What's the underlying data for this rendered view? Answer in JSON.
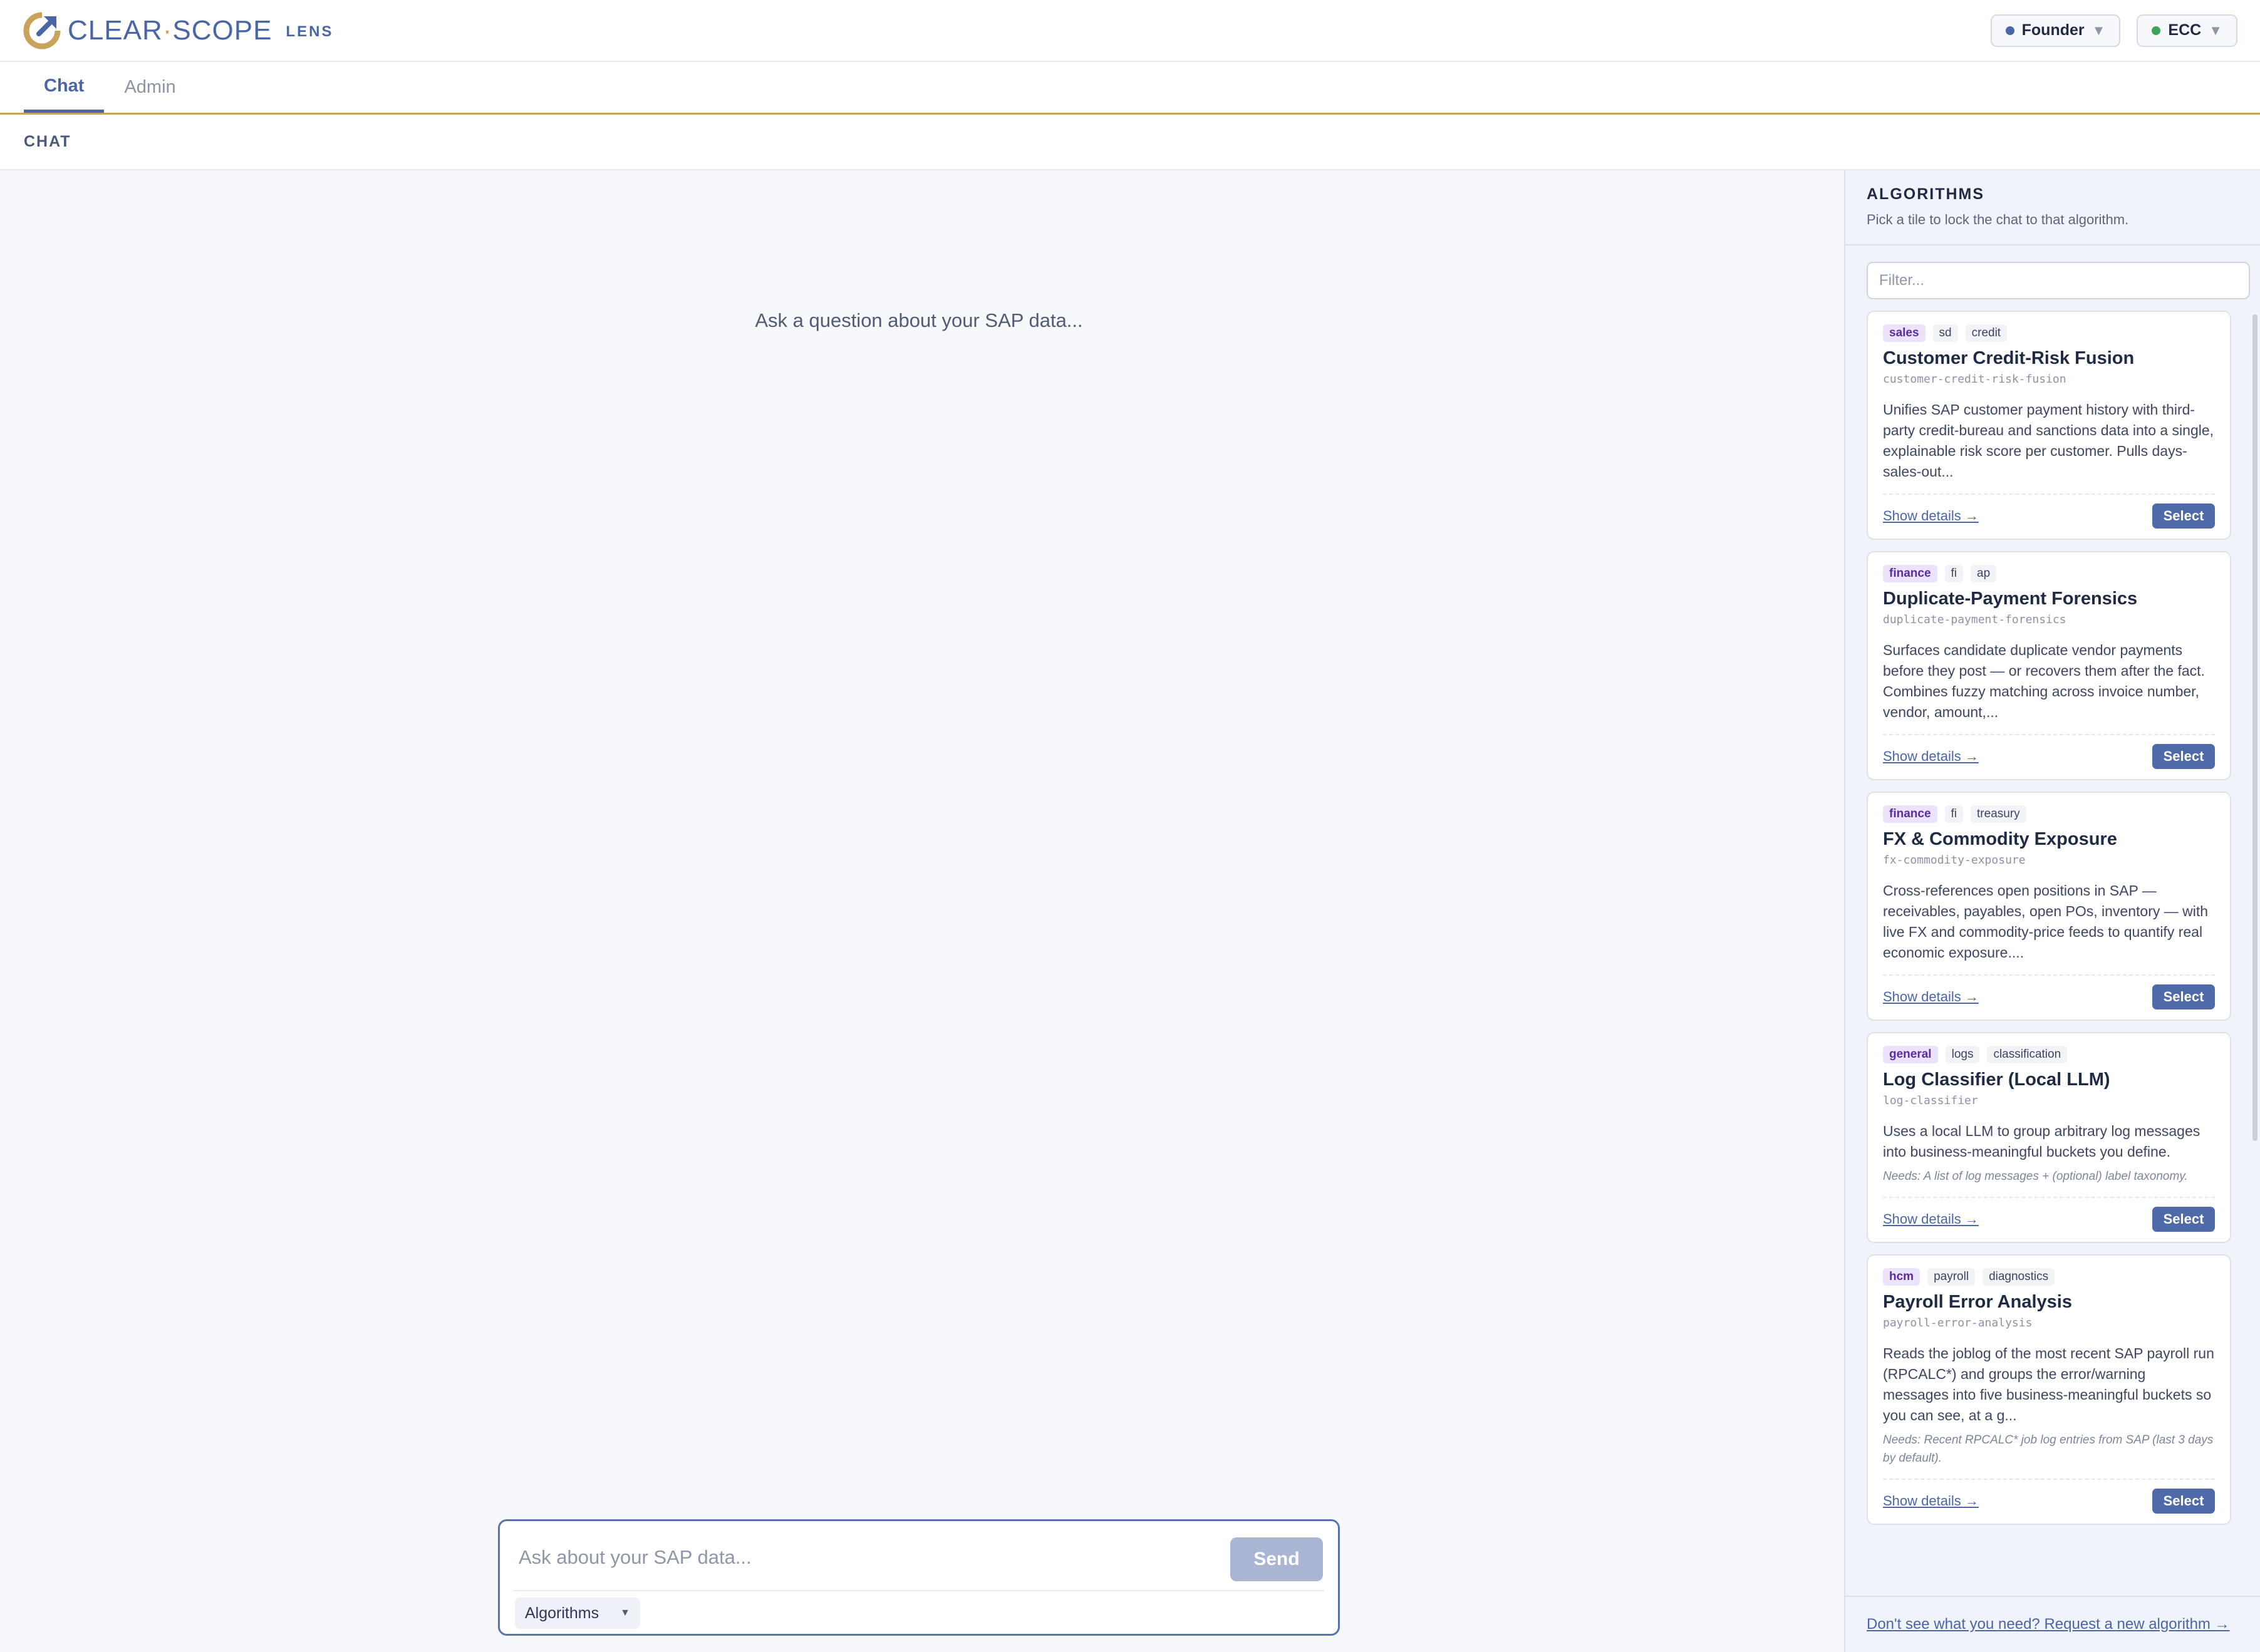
{
  "brand": {
    "name_left": "CLEAR",
    "separator": "·",
    "name_right": "SCOPE",
    "product": "LENS",
    "primary_color": "#4b66a6",
    "accent_color": "#c9a35c"
  },
  "header": {
    "role_selector": {
      "label": "Founder",
      "dot_color": "#4b66a6"
    },
    "system_selector": {
      "label": "ECC",
      "dot_color": "#3fa45b"
    },
    "caret": "▼"
  },
  "tabs": [
    {
      "label": "Chat",
      "active": true
    },
    {
      "label": "Admin",
      "active": false
    }
  ],
  "section": {
    "title": "CHAT"
  },
  "chat": {
    "empty_hint": "Ask a question about your SAP data...",
    "input_placeholder": "Ask about your SAP data...",
    "send_label": "Send",
    "algorithms_dropdown": "Algorithms"
  },
  "algorithms_panel": {
    "title": "ALGORITHMS",
    "subtitle": "Pick a tile to lock the chat to that algorithm.",
    "filter_placeholder": "Filter...",
    "footer_link": "Don't see what you need? Request a new algorithm →",
    "cards": [
      {
        "tags": [
          "sales",
          "sd",
          "credit"
        ],
        "title": "Customer Credit-Risk Fusion",
        "slug": "customer-credit-risk-fusion",
        "description": "Unifies SAP customer payment history with third-party credit-bureau and sanctions data into a single, explainable risk score per customer. Pulls days-sales-out...",
        "needs": "",
        "details_label": "Show details →",
        "select_label": "Select"
      },
      {
        "tags": [
          "finance",
          "fi",
          "ap"
        ],
        "title": "Duplicate-Payment Forensics",
        "slug": "duplicate-payment-forensics",
        "description": "Surfaces candidate duplicate vendor payments before they post — or recovers them after the fact. Combines fuzzy matching across invoice number, vendor, amount,...",
        "needs": "",
        "details_label": "Show details →",
        "select_label": "Select"
      },
      {
        "tags": [
          "finance",
          "fi",
          "treasury"
        ],
        "title": "FX & Commodity Exposure",
        "slug": "fx-commodity-exposure",
        "description": "Cross-references open positions in SAP — receivables, payables, open POs, inventory — with live FX and commodity-price feeds to quantify real economic exposure....",
        "needs": "",
        "details_label": "Show details →",
        "select_label": "Select"
      },
      {
        "tags": [
          "general",
          "logs",
          "classification"
        ],
        "title": "Log Classifier (Local LLM)",
        "slug": "log-classifier",
        "description": "Uses a local LLM to group arbitrary log messages into business-meaningful buckets you define.",
        "needs": "Needs: A list of log messages + (optional) label taxonomy.",
        "details_label": "Show details →",
        "select_label": "Select"
      },
      {
        "tags": [
          "hcm",
          "payroll",
          "diagnostics"
        ],
        "title": "Payroll Error Analysis",
        "slug": "payroll-error-analysis",
        "description": "Reads the joblog of the most recent SAP payroll run (RPCALC*) and groups the error/warning messages into five business-meaningful buckets so you can see, at a g...",
        "needs": "Needs: Recent RPCALC* job log entries from SAP (last 3 days by default).",
        "details_label": "Show details →",
        "select_label": "Select"
      }
    ]
  }
}
